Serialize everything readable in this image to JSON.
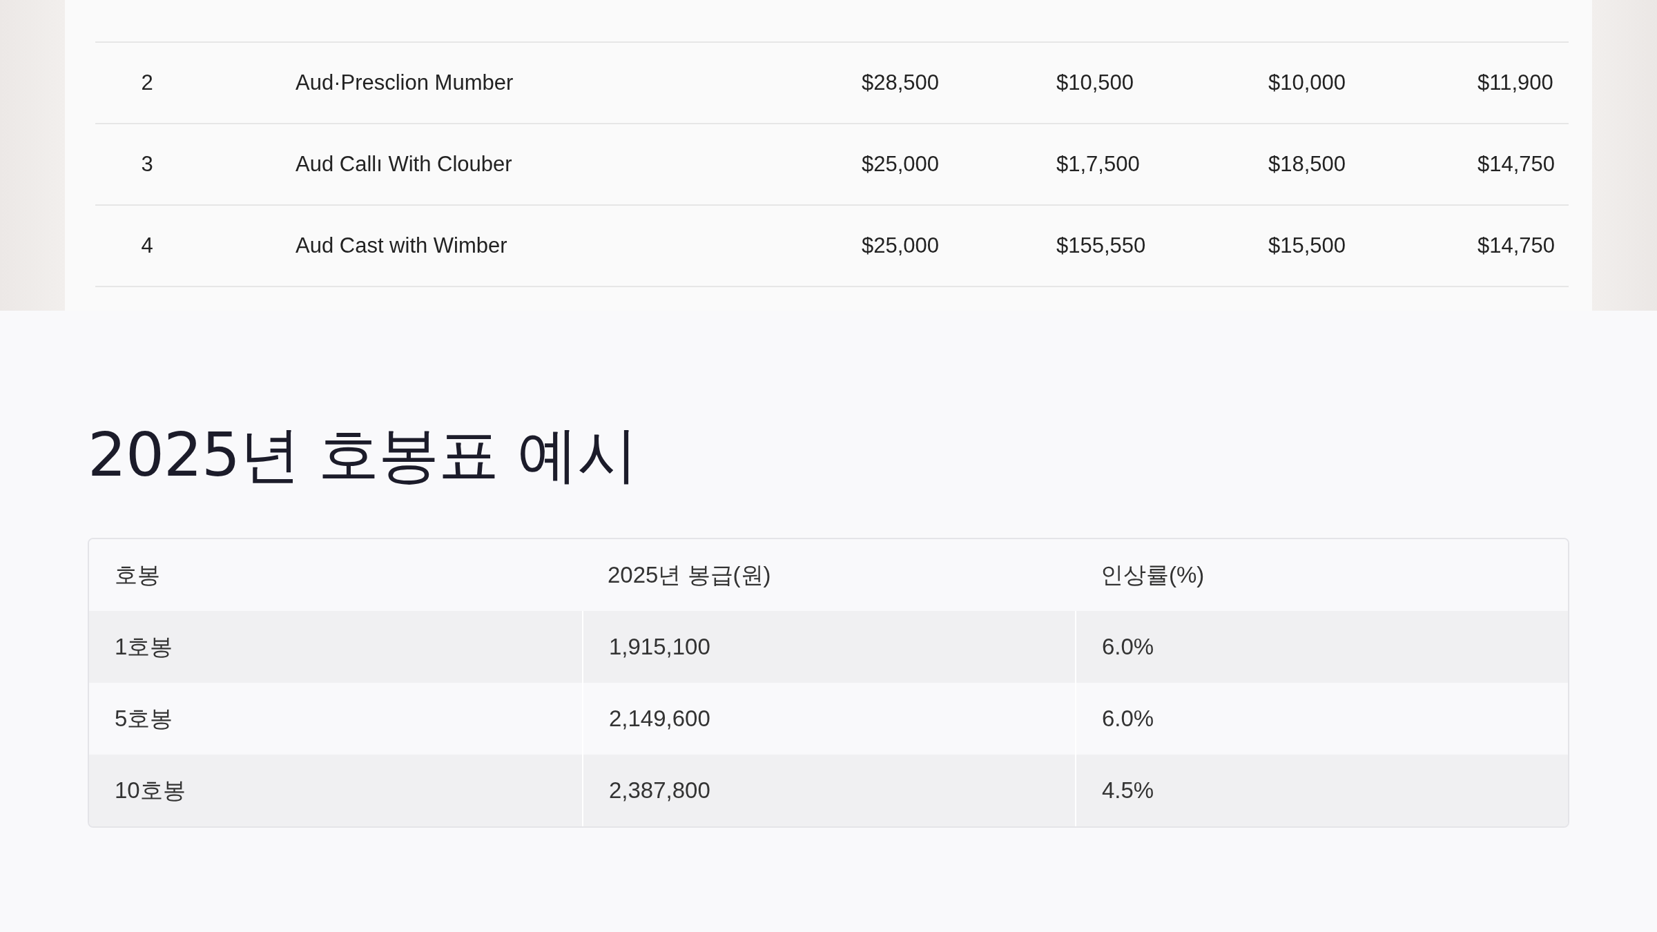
{
  "salary_image": {
    "rows": [
      {
        "number": "2",
        "name": "Aud·Presclion Mumber",
        "values": [
          "$28,500",
          "$10,500",
          "$10,000",
          "$11,900"
        ]
      },
      {
        "number": "3",
        "name": "Aud Callı With Clouber",
        "values": [
          "$25,000",
          "$1,7,500",
          "$18,500",
          "$14,750"
        ]
      },
      {
        "number": "4",
        "name": "Aud Cast with Wimber",
        "values": [
          "$25,000",
          "$155,550",
          "$15,500",
          "$14,750"
        ]
      }
    ]
  },
  "heading": "2025년 호봉표 예시",
  "table": {
    "columns": [
      "호봉",
      "2025년 봉급(원)",
      "인상률(%)"
    ],
    "rows": [
      [
        "1호봉",
        "1,915,100",
        "6.0%"
      ],
      [
        "5호봉",
        "2,149,600",
        "6.0%"
      ],
      [
        "10호봉",
        "2,387,800",
        "4.5%"
      ]
    ]
  }
}
